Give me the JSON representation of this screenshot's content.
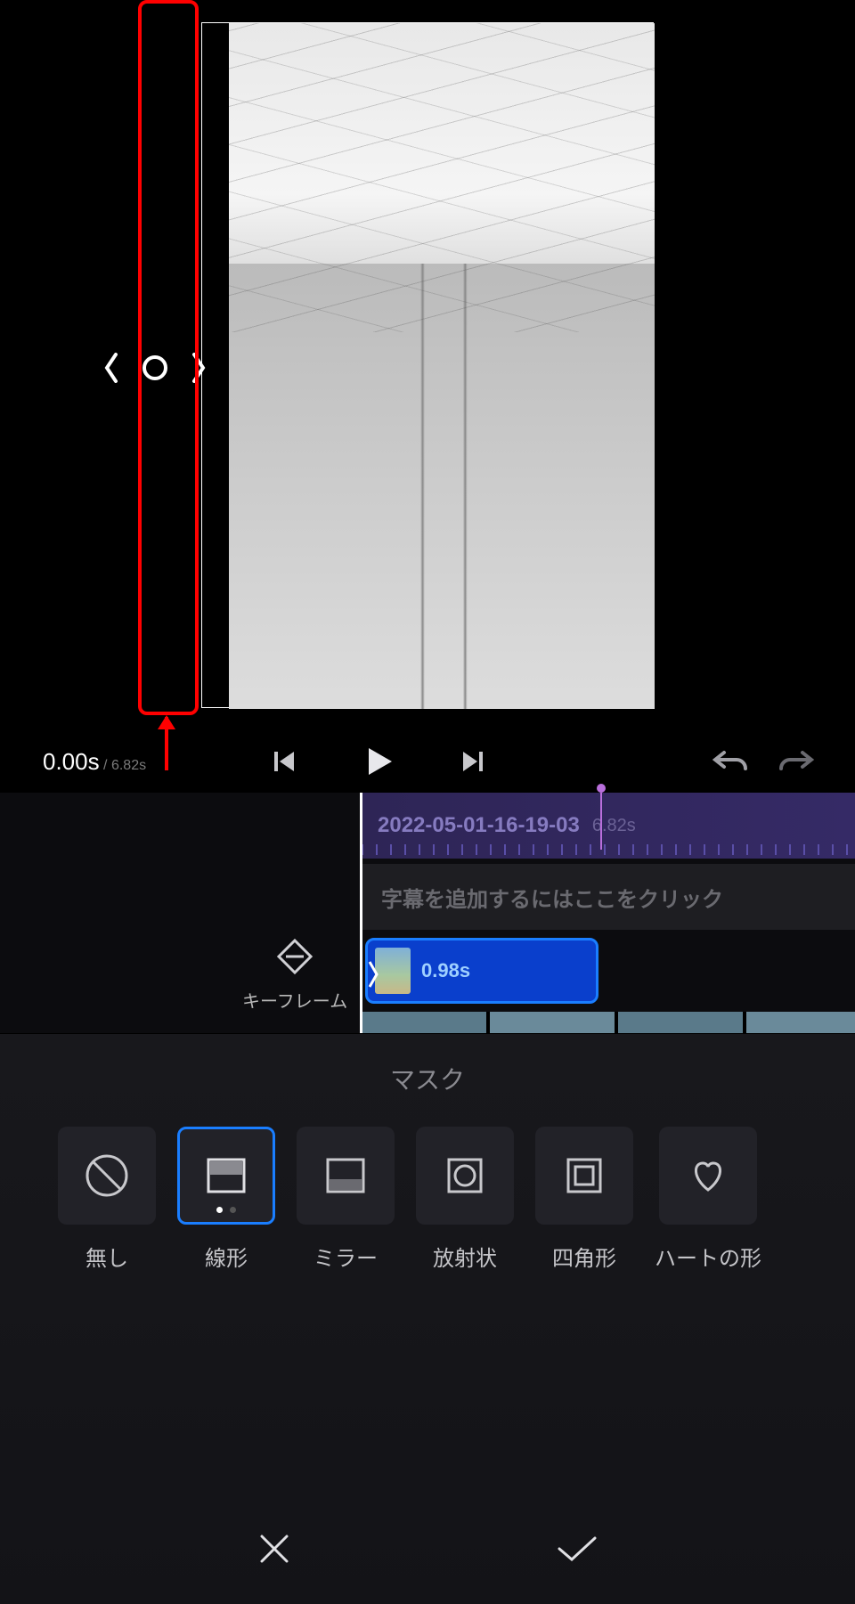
{
  "time": {
    "current": "0.00s",
    "separator": " / ",
    "total": "6.82s"
  },
  "timeline": {
    "clip_name": "2022-05-01-16-19-03",
    "clip_total_dur": "6.82s",
    "caption_hint": "字幕を追加するにはここをクリック",
    "selected_clip_dur": "0.98s"
  },
  "keyframe": {
    "label": "キーフレーム"
  },
  "panel": {
    "title": "マスク",
    "items": [
      {
        "id": "none",
        "label": "無し"
      },
      {
        "id": "linear",
        "label": "線形",
        "selected": true
      },
      {
        "id": "mirror",
        "label": "ミラー"
      },
      {
        "id": "radial",
        "label": "放射状"
      },
      {
        "id": "rect",
        "label": "四角形"
      },
      {
        "id": "heart",
        "label": "ハートの形"
      }
    ]
  }
}
